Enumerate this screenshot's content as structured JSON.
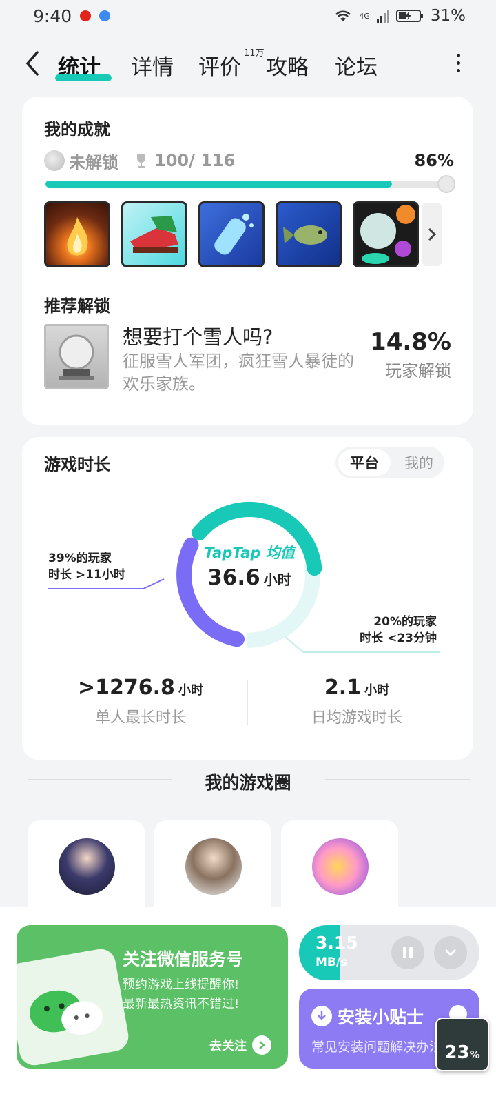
{
  "status": {
    "time": "9:40",
    "network": "4G",
    "battery": "31%"
  },
  "nav": {
    "tabs": [
      {
        "label": "统计"
      },
      {
        "label": "详情"
      },
      {
        "label": "评价"
      },
      {
        "label": "攻略"
      },
      {
        "label": "论坛"
      }
    ],
    "review_count": "11万"
  },
  "achievements": {
    "title": "我的成就",
    "lock_label": "未解锁",
    "count": "100/ 116",
    "percent": "86%",
    "progress": 0.86,
    "recommend_title": "推荐解锁",
    "recommended": {
      "name": "想要打个雪人吗?",
      "desc": "征服雪人军团，疯狂雪人暴徒的欢乐家族。",
      "percent": "14.8%",
      "percent_label": "玩家解锁"
    }
  },
  "playtime": {
    "title": "游戏时长",
    "toggle": {
      "on": "平台",
      "off": "我的"
    },
    "center_brand": "TapTap 均值",
    "center_value": "36.6",
    "center_unit": "小时",
    "left_legend_1": "39%的玩家",
    "left_legend_2": "时长 >11小时",
    "right_legend_1": "20%的玩家",
    "right_legend_2": "时长 <23分钟",
    "max_value": ">1276.8",
    "max_unit": "小时",
    "max_label": "单人最长时长",
    "daily_value": "2.1",
    "daily_unit": "小时",
    "daily_label": "日均游戏时长",
    "colors": {
      "teal": "#19c9b7",
      "purple": "#7b6cf6",
      "light": "#e3f7f6"
    }
  },
  "circle": {
    "title": "我的游戏圈"
  },
  "promo": {
    "title": "关注微信服务号",
    "line1": "预约游戏上线提醒你!",
    "line2": "最新最热资讯不错过!",
    "button": "去关注"
  },
  "download": {
    "speed": "3.15",
    "unit": "MB/s",
    "progress": 0.23,
    "percent_num": "23",
    "percent_sign": "%"
  },
  "tips": {
    "title": "安装小贴士",
    "subtitle": "常见安装问题解决办法"
  }
}
